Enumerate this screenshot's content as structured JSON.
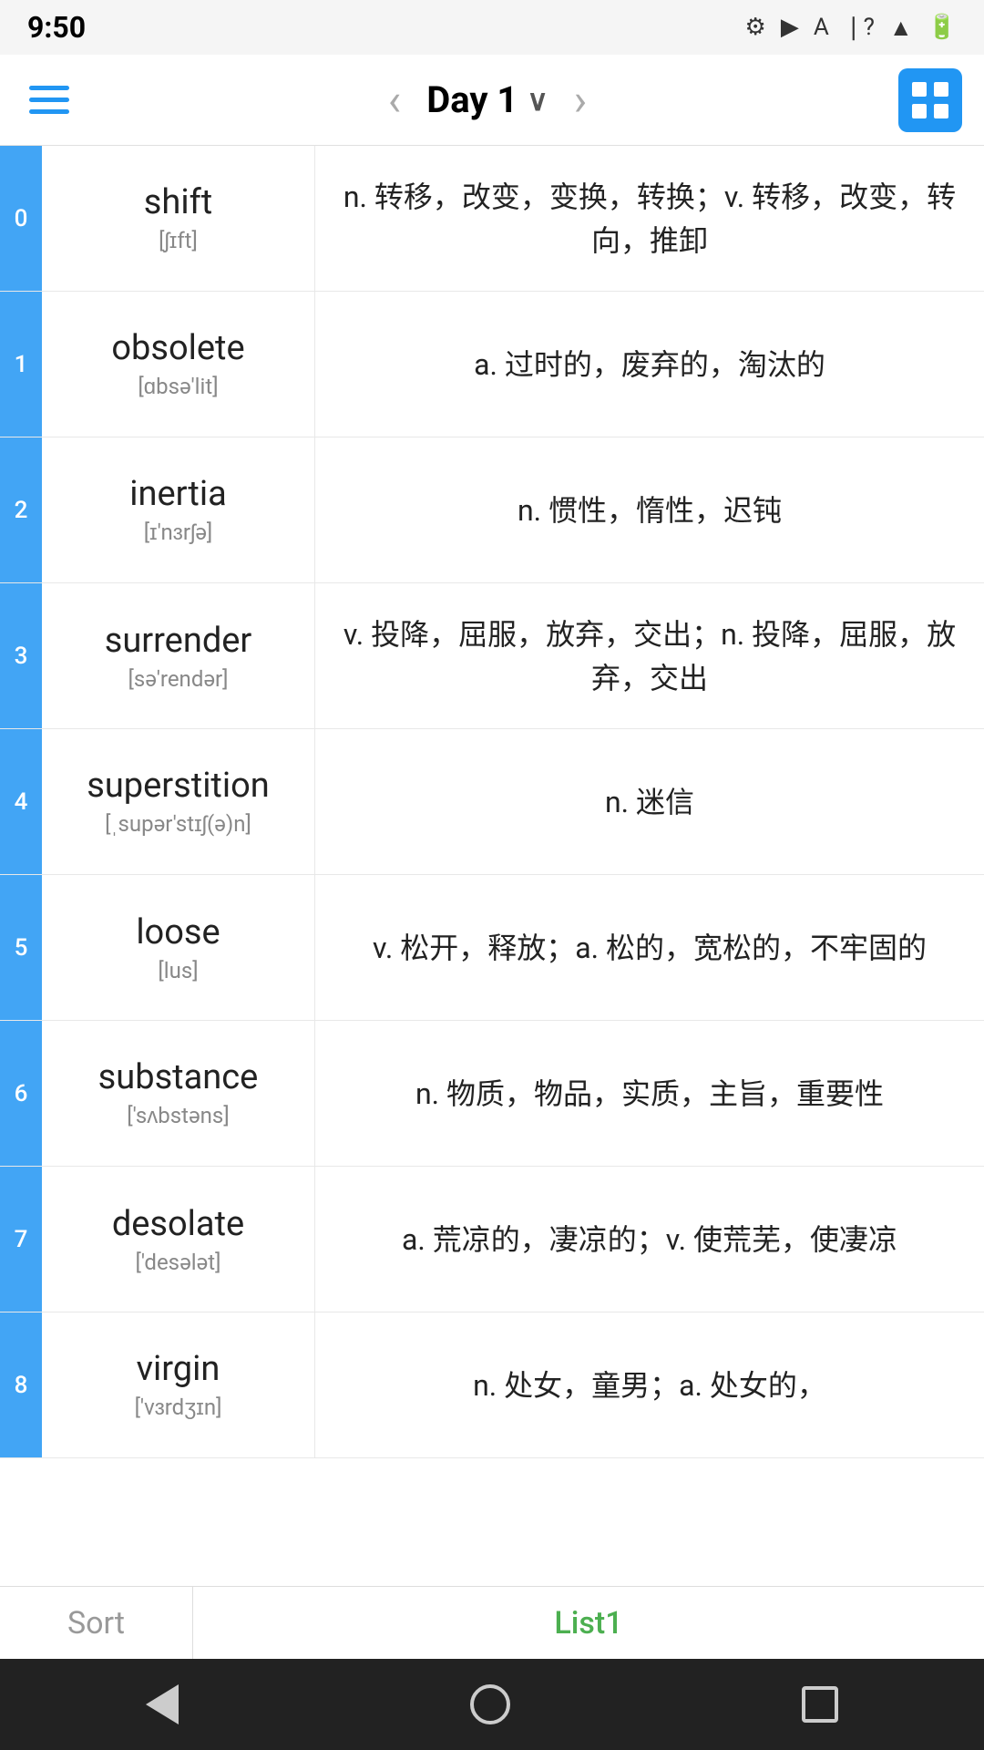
{
  "status": {
    "time": "9:50",
    "icons": [
      "⚙",
      "▶",
      "A",
      "?",
      "•"
    ]
  },
  "nav": {
    "title": "Day 1",
    "prev_label": "‹",
    "next_label": "›",
    "chevron": "∨",
    "hamburger_label": "menu",
    "grid_label": "grid-view"
  },
  "words": [
    {
      "index": "0",
      "english": "shift",
      "phonetic": "[ʃɪft]",
      "definition": "n. 转移，改变，变换，转换；v. 转移，改变，转向，推卸"
    },
    {
      "index": "1",
      "english": "obsolete",
      "phonetic": "[ɑbsə'lit]",
      "definition": "a. 过时的，废弃的，淘汰的"
    },
    {
      "index": "2",
      "english": "inertia",
      "phonetic": "[ɪ'nɜrʃə]",
      "definition": "n. 惯性，惰性，迟钝"
    },
    {
      "index": "3",
      "english": "surrender",
      "phonetic": "[sə'rendər]",
      "definition": "v. 投降，屈服，放弃，交出；n. 投降，屈服，放弃，交出"
    },
    {
      "index": "4",
      "english": "superstition",
      "phonetic": "[ˌsupər'stɪʃ(ə)n]",
      "definition": "n. 迷信"
    },
    {
      "index": "5",
      "english": "loose",
      "phonetic": "[lus]",
      "definition": "v. 松开，释放；a. 松的，宽松的，不牢固的"
    },
    {
      "index": "6",
      "english": "substance",
      "phonetic": "['sʌbstəns]",
      "definition": "n. 物质，物品，实质，主旨，重要性"
    },
    {
      "index": "7",
      "english": "desolate",
      "phonetic": "['desələt]",
      "definition": "a. 荒凉的，凄凉的；v. 使荒芜，使凄凉"
    },
    {
      "index": "8",
      "english": "virgin",
      "phonetic": "['vɜrdʒɪn]",
      "definition": "n. 处女，童男；a. 处女的，"
    }
  ],
  "bottom_tabs": {
    "sort_label": "Sort",
    "list1_label": "List1"
  },
  "android_nav": {
    "back": "back",
    "home": "home",
    "recents": "recents"
  }
}
